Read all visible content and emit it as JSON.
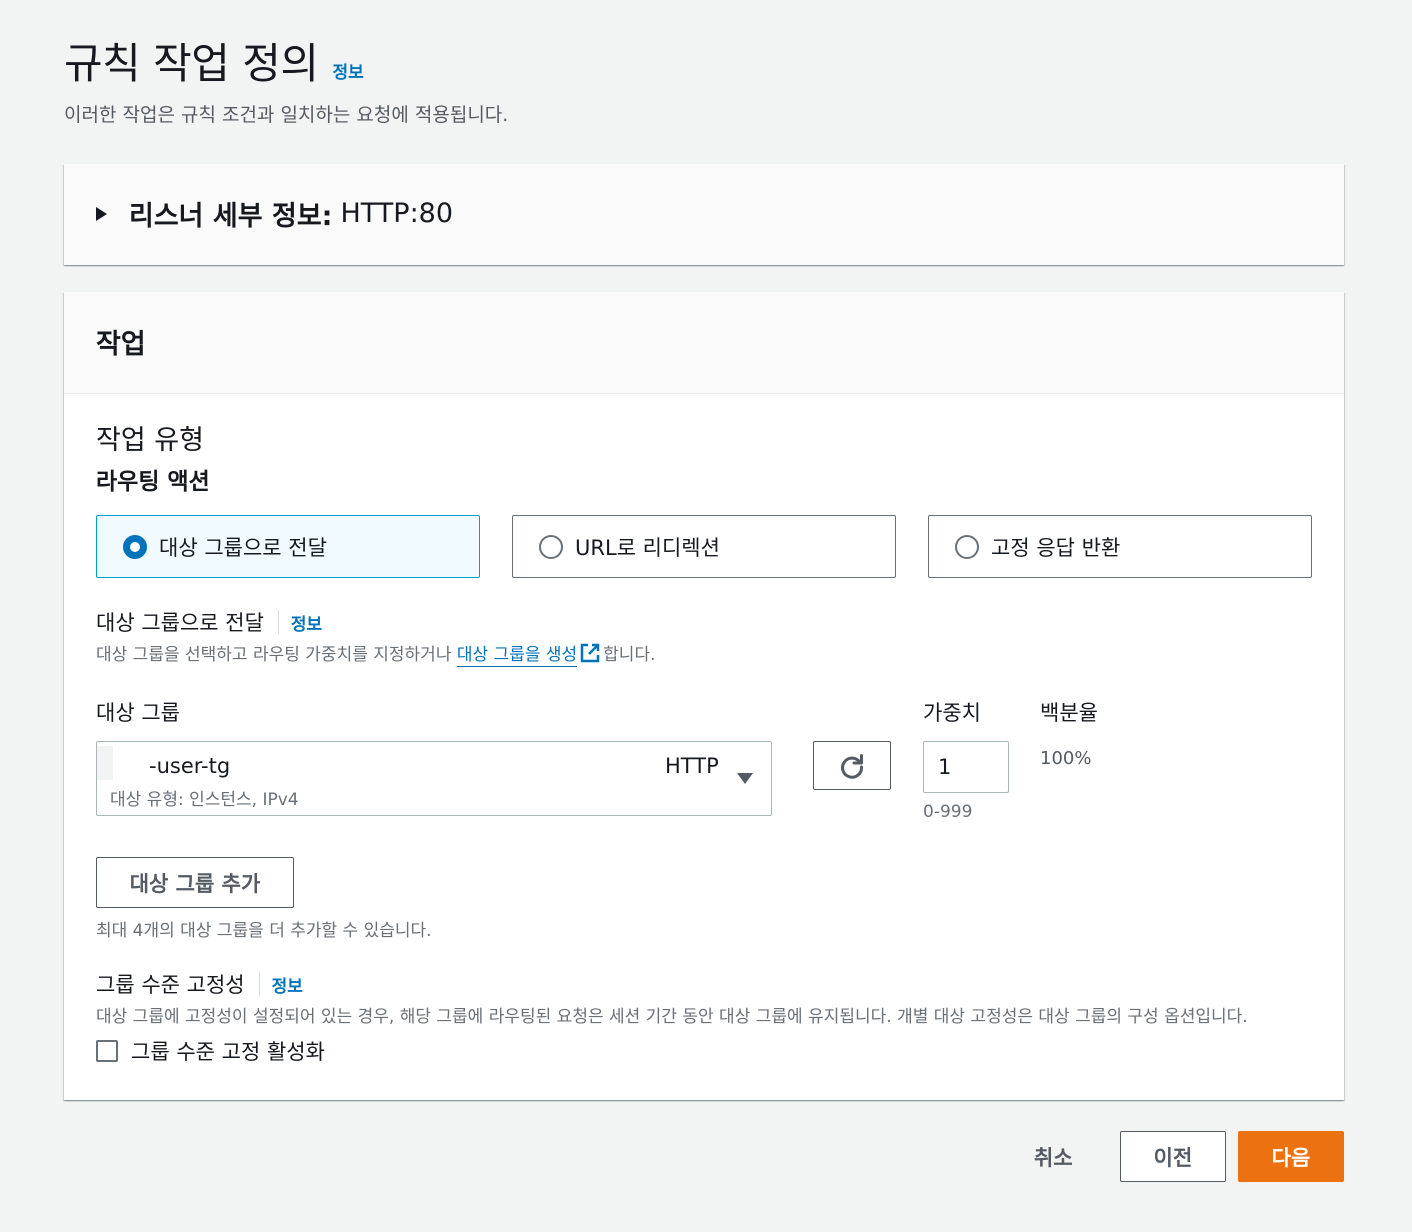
{
  "page": {
    "title": "규칙 작업 정의",
    "info": "정보",
    "description": "이러한 작업은 규칙 조건과 일치하는 요청에 적용됩니다."
  },
  "listener": {
    "label": "리스너 세부 정보:",
    "value": "HTTP:80"
  },
  "actions": {
    "header": "작업",
    "action_type_label": "작업 유형",
    "routing_label": "라우팅 액션",
    "options": [
      {
        "label": "대상 그룹으로 전달",
        "selected": true
      },
      {
        "label": "URL로 리디렉션",
        "selected": false
      },
      {
        "label": "고정 응답 반환",
        "selected": false
      }
    ],
    "forward": {
      "label": "대상 그룹으로 전달",
      "info": "정보",
      "desc_before": "대상 그룹을 선택하고 라우팅 가중치를 지정하거나 ",
      "desc_link": "대상 그룹을 생성",
      "desc_after": "합니다.",
      "link_icon": "external-link-icon"
    },
    "columns": {
      "target_group": "대상 그룹",
      "weight": "가중치",
      "percent": "백분율"
    },
    "target_group": {
      "name": "-user-tg",
      "protocol": "HTTP",
      "subtext": "대상 유형: 인스턴스, IPv4",
      "weight": "1",
      "weight_hint": "0-999",
      "percent": "100%"
    },
    "refresh_icon": "refresh-icon",
    "add_button": "대상 그룹 추가",
    "add_hint": "최대 4개의 대상 그룹을 더 추가할 수 있습니다.",
    "stickiness": {
      "label": "그룹 수준 고정성",
      "info": "정보",
      "description": "대상 그룹에 고정성이 설정되어 있는 경우, 해당 그룹에 라우팅된 요청은 세션 기간 동안 대상 그룹에 유지됩니다. 개별 대상 고정성은 대상 그룹의 구성 옵션입니다.",
      "checkbox_label": "그룹 수준 고정 활성화",
      "checked": false
    }
  },
  "footer": {
    "cancel": "취소",
    "previous": "이전",
    "next": "다음"
  },
  "colors": {
    "link": "#0073bb",
    "primary": "#ec7211",
    "selected_bg": "#f1faff",
    "selected_border": "#00a1c9"
  }
}
